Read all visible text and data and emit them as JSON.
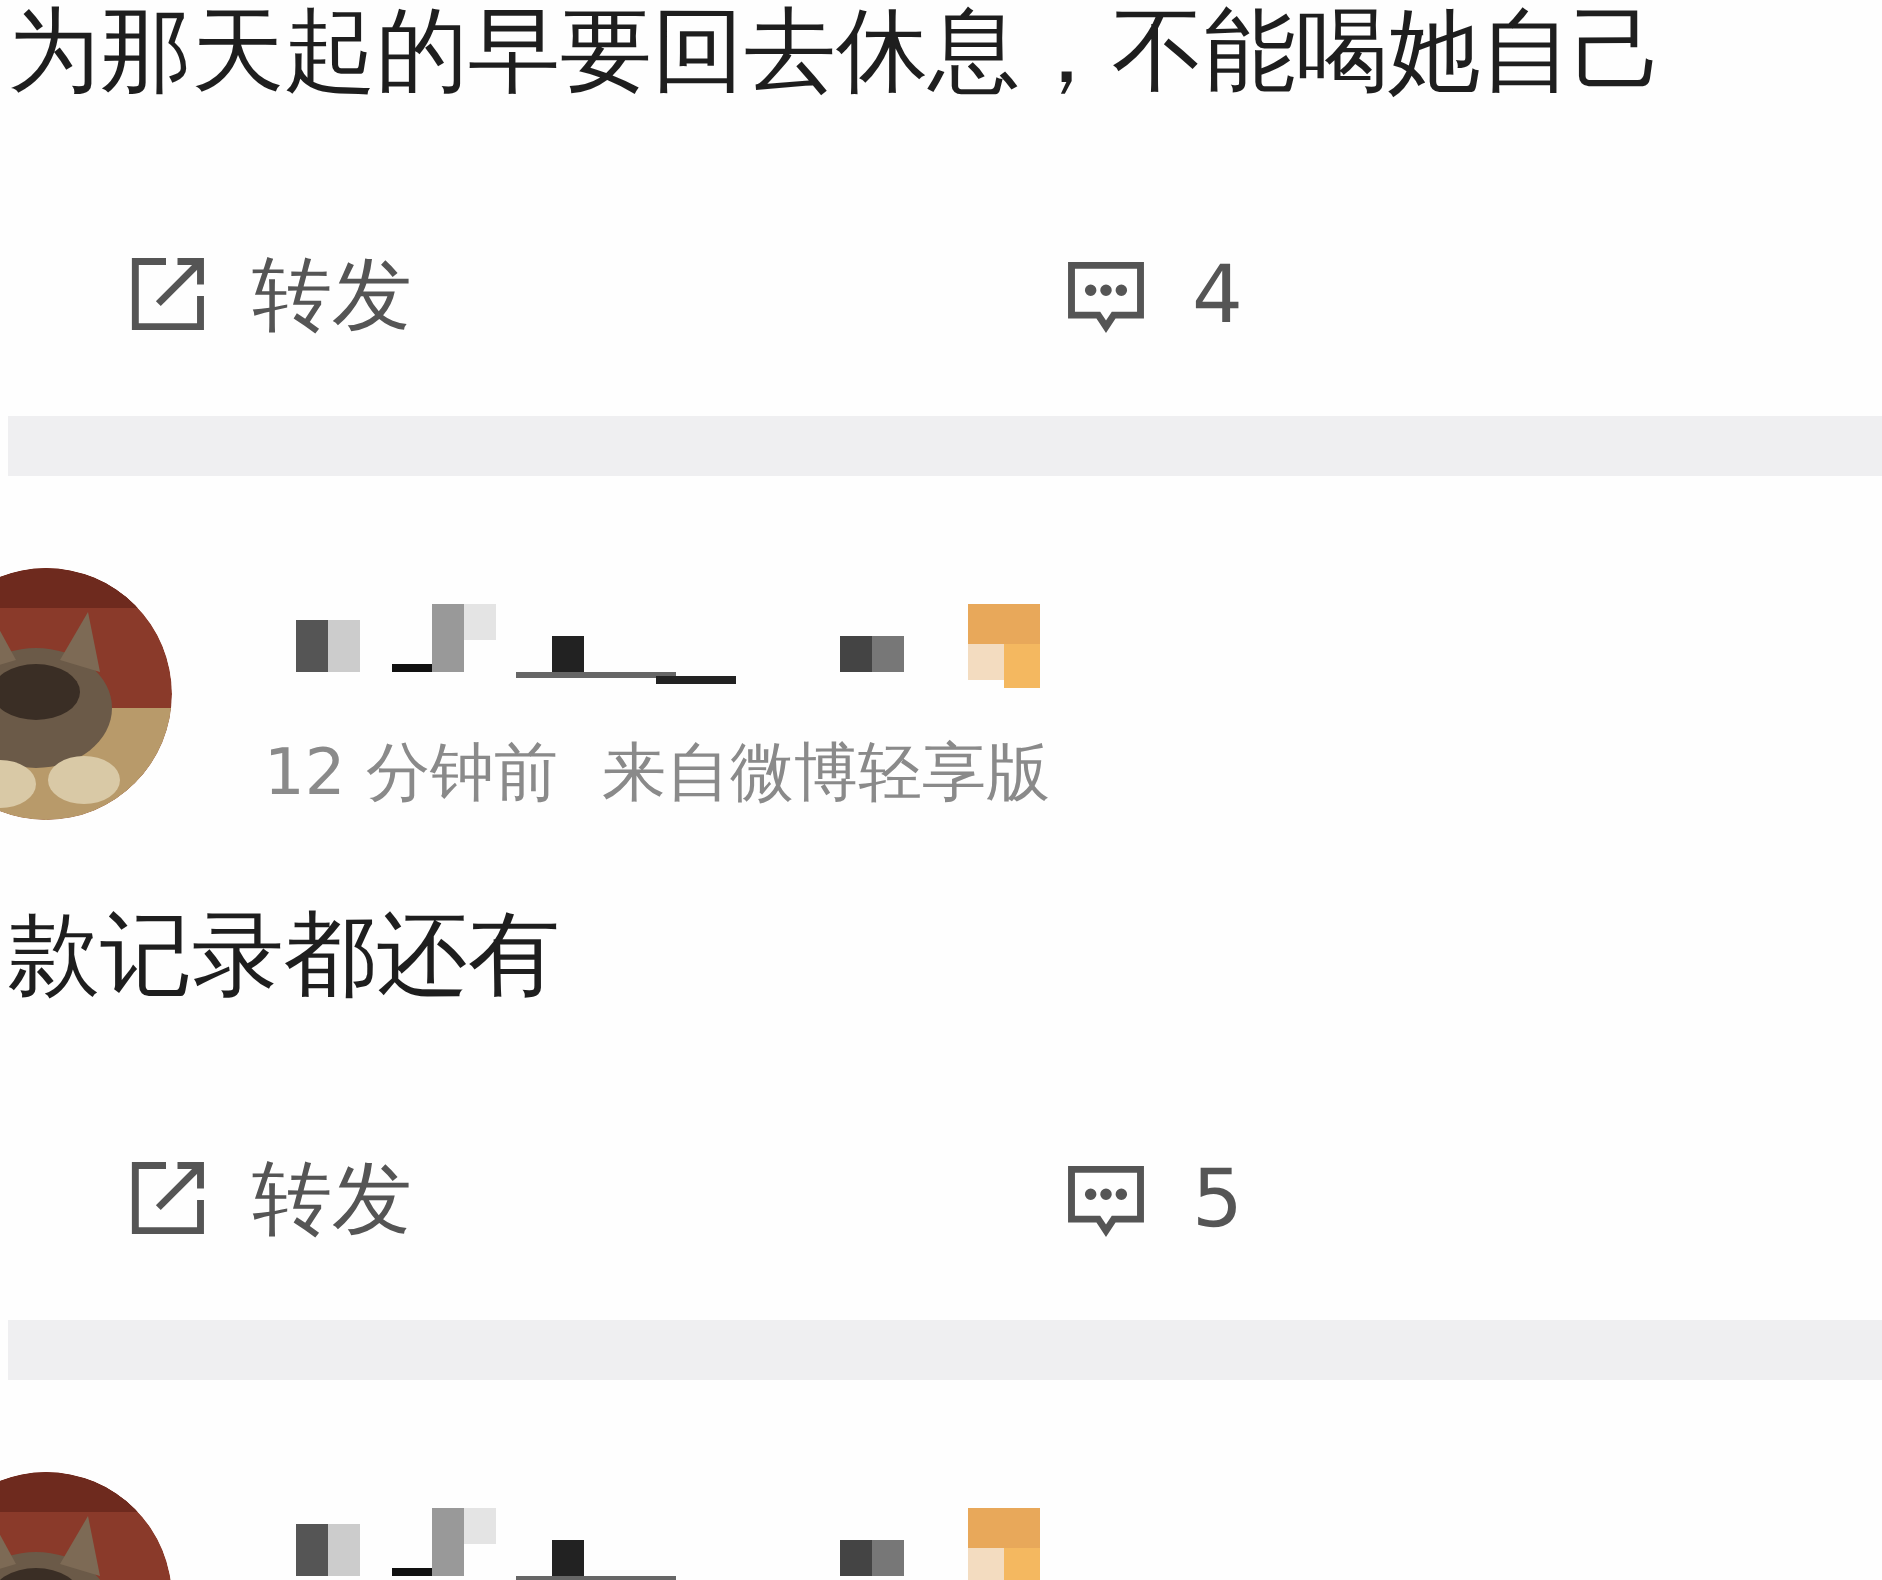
{
  "posts": [
    {
      "text": "为那天起的早要回去休息，不能喝她自己",
      "repost": "转发",
      "comments": "4"
    },
    {
      "avatar": {
        "kind": "picture"
      },
      "time": "12 分钟前",
      "source": "来自微博轻享版",
      "text": "款记录都还有",
      "repost": "转发",
      "comments": "5"
    },
    {
      "avatar": {
        "kind": "picture"
      }
    }
  ]
}
